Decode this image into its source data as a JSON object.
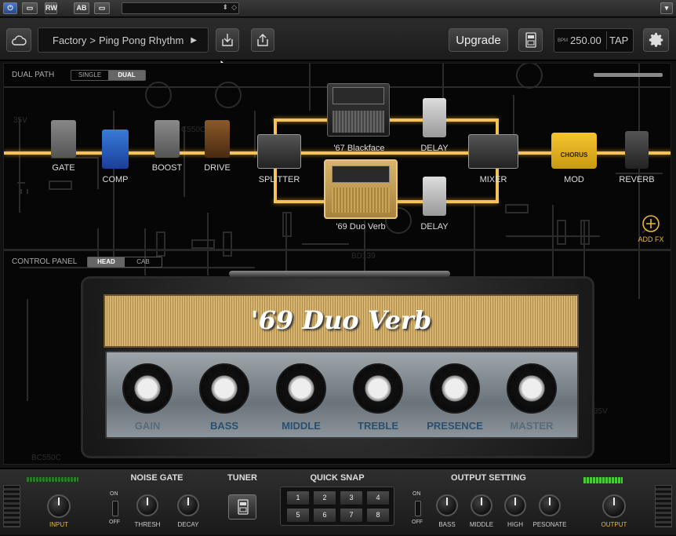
{
  "host_bar": {
    "buttons": [
      "⏻",
      "▭",
      "RW",
      "AB",
      "▭"
    ],
    "dropdown_value": ""
  },
  "toolbar": {
    "preset_bank": "Factory",
    "preset_sep": ">",
    "preset_name": "Ping Pong Rhythm",
    "play_icon": "▶",
    "upgrade_label": "Upgrade",
    "bpm_label": "BPM",
    "bpm_value": "250.00",
    "tap_label": "TAP"
  },
  "signal_path": {
    "mode_label": "DUAL PATH",
    "mode_options": [
      "SINGLE",
      "DUAL"
    ],
    "mode_selected": "DUAL",
    "blocks": [
      {
        "name": "GATE"
      },
      {
        "name": "COMP"
      },
      {
        "name": "BOOST"
      },
      {
        "name": "DRIVE"
      },
      {
        "name": "SPLITTER"
      },
      {
        "name": "'67 Blackface"
      },
      {
        "name": "DELAY"
      },
      {
        "name": "'69 Duo Verb"
      },
      {
        "name": "DELAY"
      },
      {
        "name": "MIXER"
      },
      {
        "name": "MOD"
      },
      {
        "name": "REVERB"
      }
    ],
    "chorus_label": "CHORUS",
    "add_fx_label": "ADD FX"
  },
  "control_panel": {
    "label": "CONTROL PANEL",
    "view_options": [
      "HEAD",
      "CAB"
    ],
    "view_selected": "HEAD",
    "amp_title": "'69 Duo Verb",
    "knobs": [
      "GAIN",
      "BASS",
      "MIDDLE",
      "TREBLE",
      "PRESENCE",
      "MASTER"
    ],
    "knob_scale": [
      "1",
      "2",
      "3",
      "4",
      "5",
      "6",
      "7",
      "8",
      "9",
      "10"
    ]
  },
  "bottom": {
    "input_label": "INPUT",
    "noise_gate": {
      "title": "NOISE GATE",
      "on": "ON",
      "off": "OFF",
      "thresh": "THRESH",
      "decay": "DECAY"
    },
    "tuner": {
      "title": "TUNER"
    },
    "quick_snap": {
      "title": "QUICK SNAP",
      "slots": [
        "1",
        "2",
        "3",
        "4",
        "5",
        "6",
        "7",
        "8"
      ]
    },
    "output_setting": {
      "title": "OUTPUT SETTING",
      "on": "ON",
      "off": "OFF",
      "bass": "BASS",
      "middle": "MIDDLE",
      "high": "HIGH",
      "presence": "PESONATE"
    },
    "output_label": "OUTPUT"
  },
  "colors": {
    "accent": "#e8b830",
    "path_glow": "#f3c455",
    "panel_bg": "#060606"
  }
}
